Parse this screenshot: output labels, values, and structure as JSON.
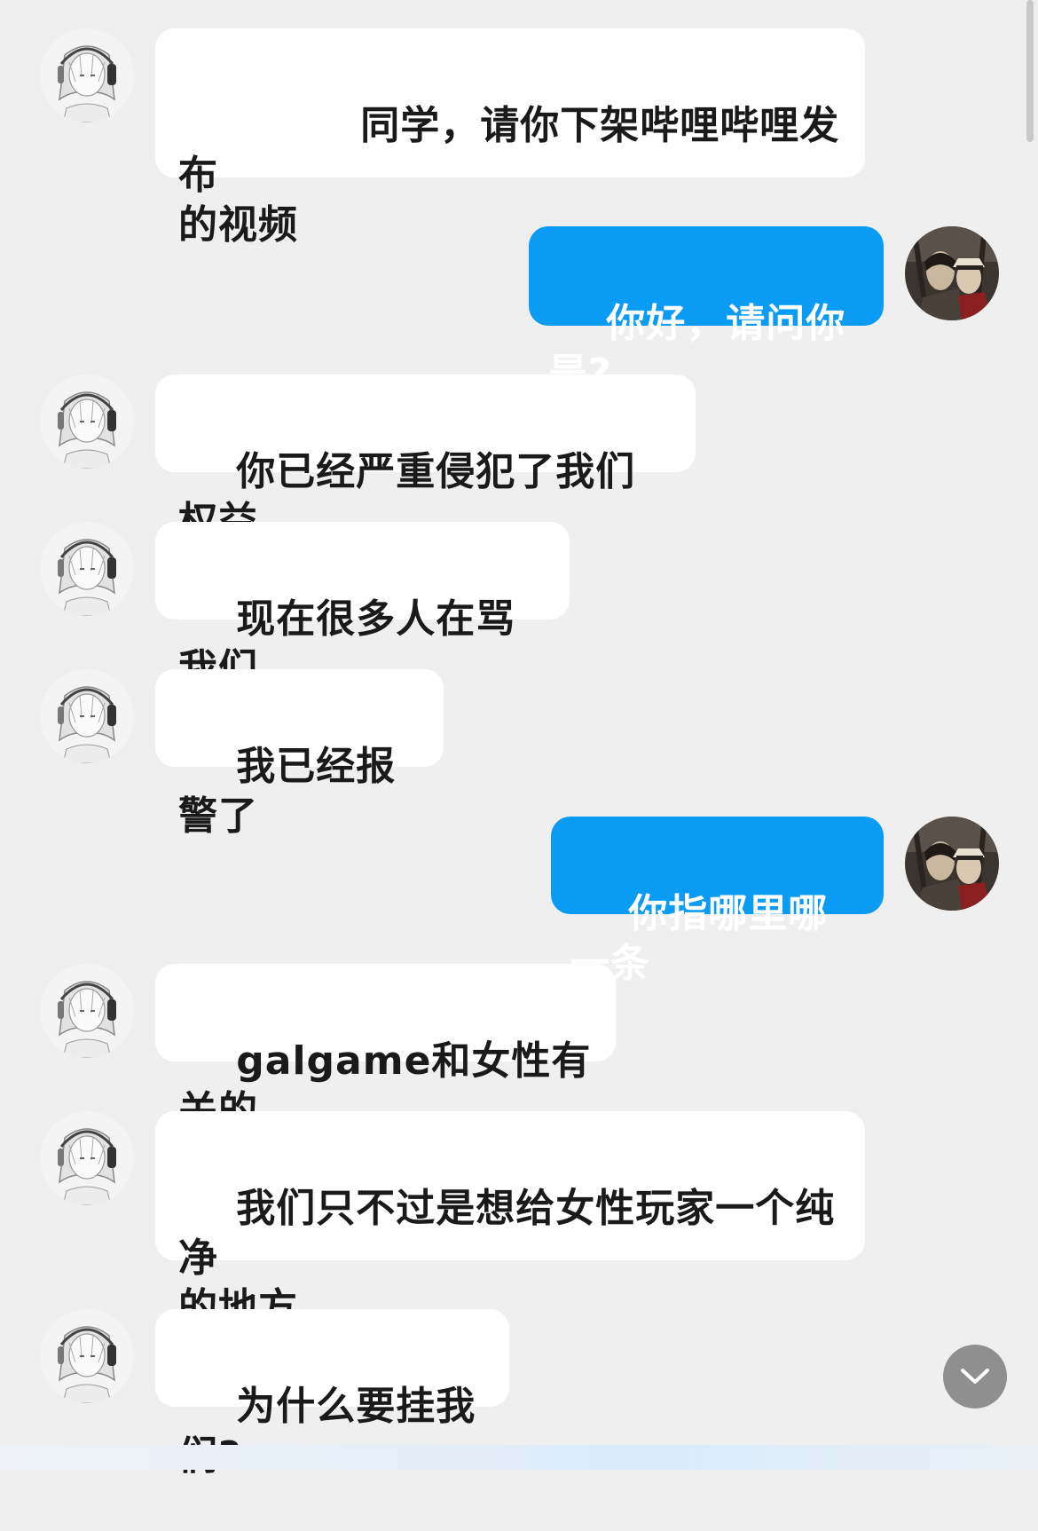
{
  "chat": {
    "messages": [
      {
        "side": "in",
        "text": "同学，请你下架哔哩哔哩发布的视频",
        "line1": "同学，请你下架哔哩哔哩发布",
        "line2": "的视频"
      },
      {
        "side": "out",
        "text": "你好，请问你是?"
      },
      {
        "side": "in",
        "text": "你已经严重侵犯了我们权益"
      },
      {
        "side": "in",
        "text": "现在很多人在骂我们"
      },
      {
        "side": "in",
        "text": "我已经报警了"
      },
      {
        "side": "out",
        "text": "你指哪里哪一条"
      },
      {
        "side": "in",
        "text": "galgame和女性有关的"
      },
      {
        "side": "in",
        "text": "我们只不过是想给女性玩家一个纯净的地方",
        "line1": "我们只不过是想给女性玩家一个纯净",
        "line2": "的地方"
      },
      {
        "side": "in",
        "text": "为什么要挂我们?"
      }
    ]
  },
  "icons": {
    "other_avatar": "manga-girl-headphones-avatar",
    "self_avatar": "dark-anime-character-avatar",
    "scroll_down": "chevron-down-icon"
  },
  "colors": {
    "background": "#f0eff0",
    "incoming_bubble": "#ffffff",
    "outgoing_bubble": "#0a9bf5",
    "scroll_button": "#8f8f8f"
  }
}
